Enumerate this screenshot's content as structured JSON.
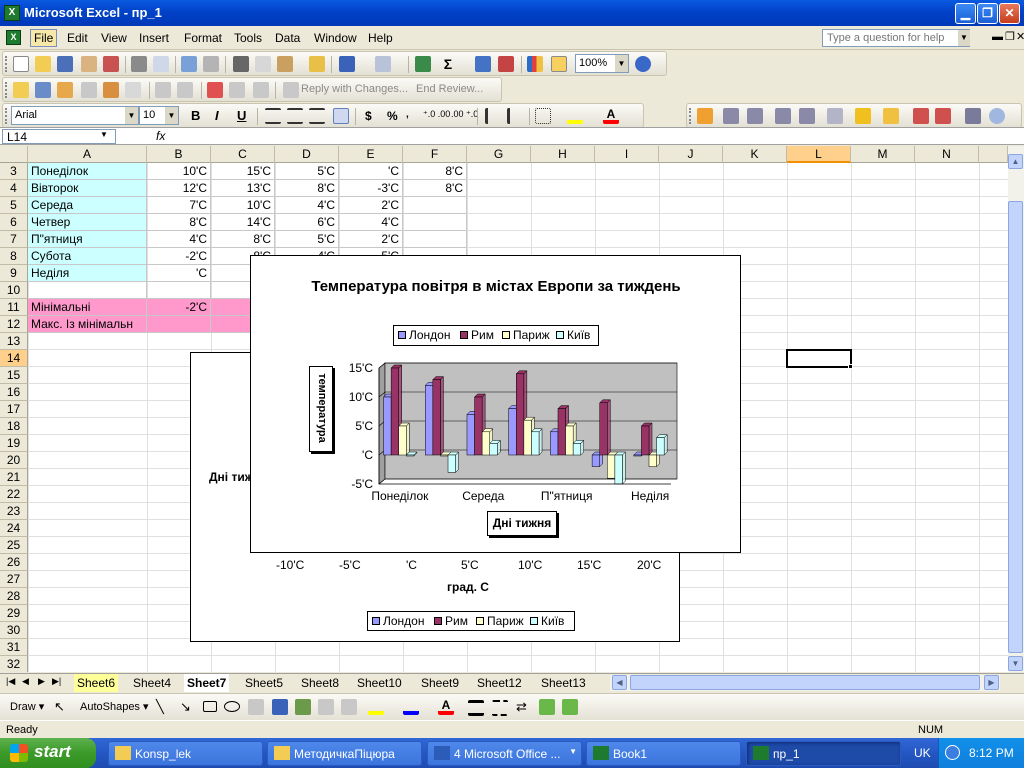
{
  "window": {
    "title": "Microsoft Excel - пр_1"
  },
  "menu": [
    "File",
    "Edit",
    "View",
    "Insert",
    "Format",
    "Tools",
    "Data",
    "Window",
    "Help"
  ],
  "help_placeholder": "Type a question for help",
  "toolbar": {
    "zoom": "100%",
    "reply_label": "Reply with Changes...",
    "end_review": "End Review...",
    "font": "Arial",
    "size": "10",
    "bold": "B",
    "italic": "I",
    "underline": "U",
    "currency": "$",
    "percent": "%",
    "inc_dec": "⁺.0 .00",
    "dec_dec": ".00 ⁺.0"
  },
  "namebox": "L14",
  "fx": "fx",
  "columns": [
    "A",
    "B",
    "C",
    "D",
    "E",
    "F",
    "G",
    "H",
    "I",
    "J",
    "K",
    "L",
    "M",
    "N"
  ],
  "rows": [
    "3",
    "4",
    "5",
    "6",
    "7",
    "8",
    "9",
    "10",
    "11",
    "12",
    "13",
    "14",
    "15",
    "16",
    "17",
    "18",
    "19",
    "20",
    "21",
    "22",
    "23",
    "24",
    "25",
    "26",
    "27",
    "28",
    "29",
    "30",
    "31",
    "32"
  ],
  "cells": {
    "a": [
      "Понеділок",
      "Вівторок",
      "Середа",
      "Четвер",
      "П\"ятниця",
      "Субота",
      "Неділя",
      "",
      "Мінімальні",
      "Макс. Із мінімальн"
    ],
    "b": [
      "10'C",
      "12'C",
      "7'C",
      "8'C",
      "4'C",
      "-2'C",
      "'C",
      "",
      "-2'C",
      ""
    ],
    "c": [
      "15'C",
      "13'C",
      "10'C",
      "14'C",
      "8'C",
      "8'C",
      "",
      "",
      "",
      ""
    ],
    "d": [
      "5'C",
      "8'C",
      "4'C",
      "6'C",
      "5'C",
      "4'C",
      "",
      "",
      "",
      ""
    ],
    "e": [
      "'C",
      "-3'C",
      "2'C",
      "4'C",
      "2'C",
      "5'C",
      "",
      "",
      "",
      ""
    ],
    "f": [
      "8'C",
      "8'C",
      "",
      "",
      "",
      "",
      "",
      "",
      "",
      ""
    ]
  },
  "chart_back": {
    "ylabel_partial": "Дні тиж",
    "x_ticks": [
      "-10'C",
      "-5'C",
      "'C",
      "5'C",
      "10'C",
      "15'C",
      "20'C"
    ],
    "xlabel": "град. С",
    "legend": [
      "Лондон",
      "Рим",
      "Париж",
      "Київ"
    ]
  },
  "chart_data": {
    "type": "bar",
    "title": "Температура повітря в містах Европи за тиждень",
    "xlabel": "Дні тижня",
    "ylabel": "температура",
    "categories": [
      "Понеділок",
      "Вівторок",
      "Середа",
      "Четвер",
      "П\"ятниця",
      "Субота",
      "Неділя"
    ],
    "category_tick_labels": [
      "Понеділок",
      "Середа",
      "П\"ятниця",
      "Неділя"
    ],
    "y_ticks": [
      "15'C",
      "10'C",
      "5'C",
      "'C",
      "-5'C"
    ],
    "ylim": [
      -5,
      15
    ],
    "legend_position": "top",
    "series": [
      {
        "name": "Лондон",
        "color": "#9999ff",
        "values": [
          10,
          12,
          7,
          8,
          4,
          -2,
          0
        ]
      },
      {
        "name": "Рим",
        "color": "#993366",
        "values": [
          15,
          13,
          10,
          14,
          8,
          9,
          5
        ]
      },
      {
        "name": "Париж",
        "color": "#ffffcc",
        "values": [
          5,
          0,
          4,
          6,
          5,
          -4,
          -2
        ]
      },
      {
        "name": "Київ",
        "color": "#ccffff",
        "values": [
          0,
          -3,
          2,
          4,
          2,
          -5,
          3
        ]
      }
    ]
  },
  "sheets": [
    "Sheet6",
    "Sheet4",
    "Sheet7",
    "Sheet5",
    "Sheet8",
    "Sheet10",
    "Sheet9",
    "Sheet12",
    "Sheet13"
  ],
  "drawbar": {
    "draw": "Draw",
    "autoshapes": "AutoShapes"
  },
  "status": {
    "left": "Ready",
    "num": "NUM"
  },
  "taskbar": {
    "start": "start",
    "tasks": [
      "Konsp_lek",
      "МетодичкаПіцюра",
      "4 Microsoft Office ...",
      "Book1",
      "пр_1"
    ],
    "lang": "UK",
    "time": "8:12 PM"
  }
}
